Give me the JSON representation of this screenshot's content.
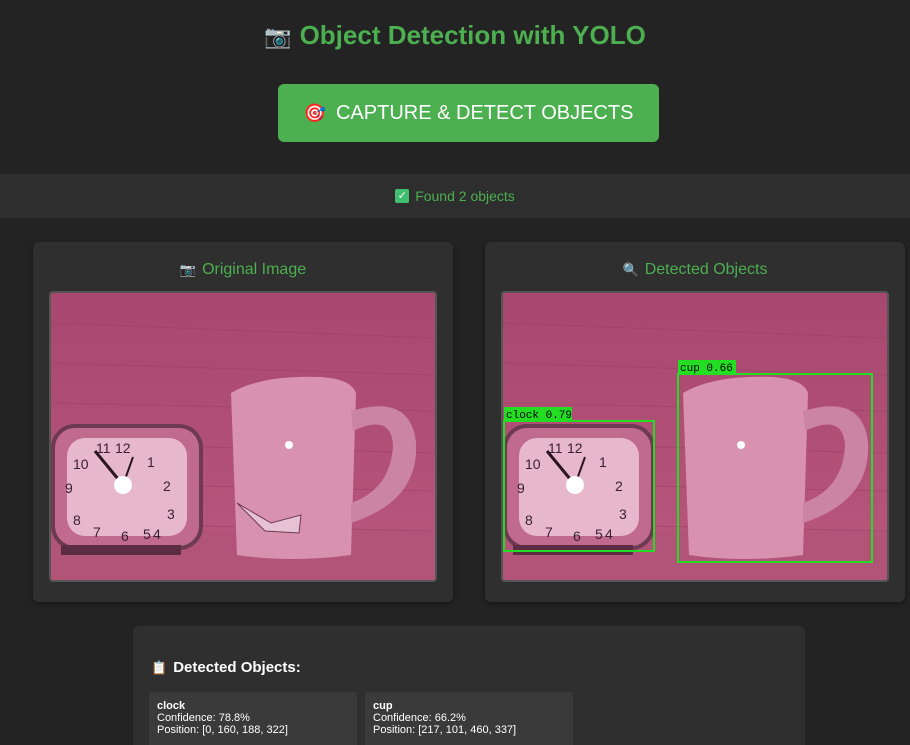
{
  "header": {
    "title": "Object Detection with YOLO",
    "title_icon": "camera-icon",
    "accent_color": "#4caf50"
  },
  "capture": {
    "label": "CAPTURE & DETECT OBJECTS",
    "icon": "target-icon"
  },
  "status": {
    "text": "Found 2 objects",
    "icon": "checkmark-icon"
  },
  "panels": {
    "original": {
      "title": "Original Image",
      "icon": "camera-icon"
    },
    "detected": {
      "title": "Detected Objects",
      "icon": "magnifier-icon"
    }
  },
  "overlay_labels": {
    "clock": "clock 0.79",
    "cup": "cup 0.66"
  },
  "detections": {
    "title": "Detected Objects:",
    "icon": "clipboard-icon",
    "items": [
      {
        "name": "clock",
        "confidence": "Confidence: 78.8%",
        "position": "Position: [0, 160, 188, 322]"
      },
      {
        "name": "cup",
        "confidence": "Confidence: 66.2%",
        "position": "Position: [217, 101, 460, 337]"
      }
    ]
  }
}
